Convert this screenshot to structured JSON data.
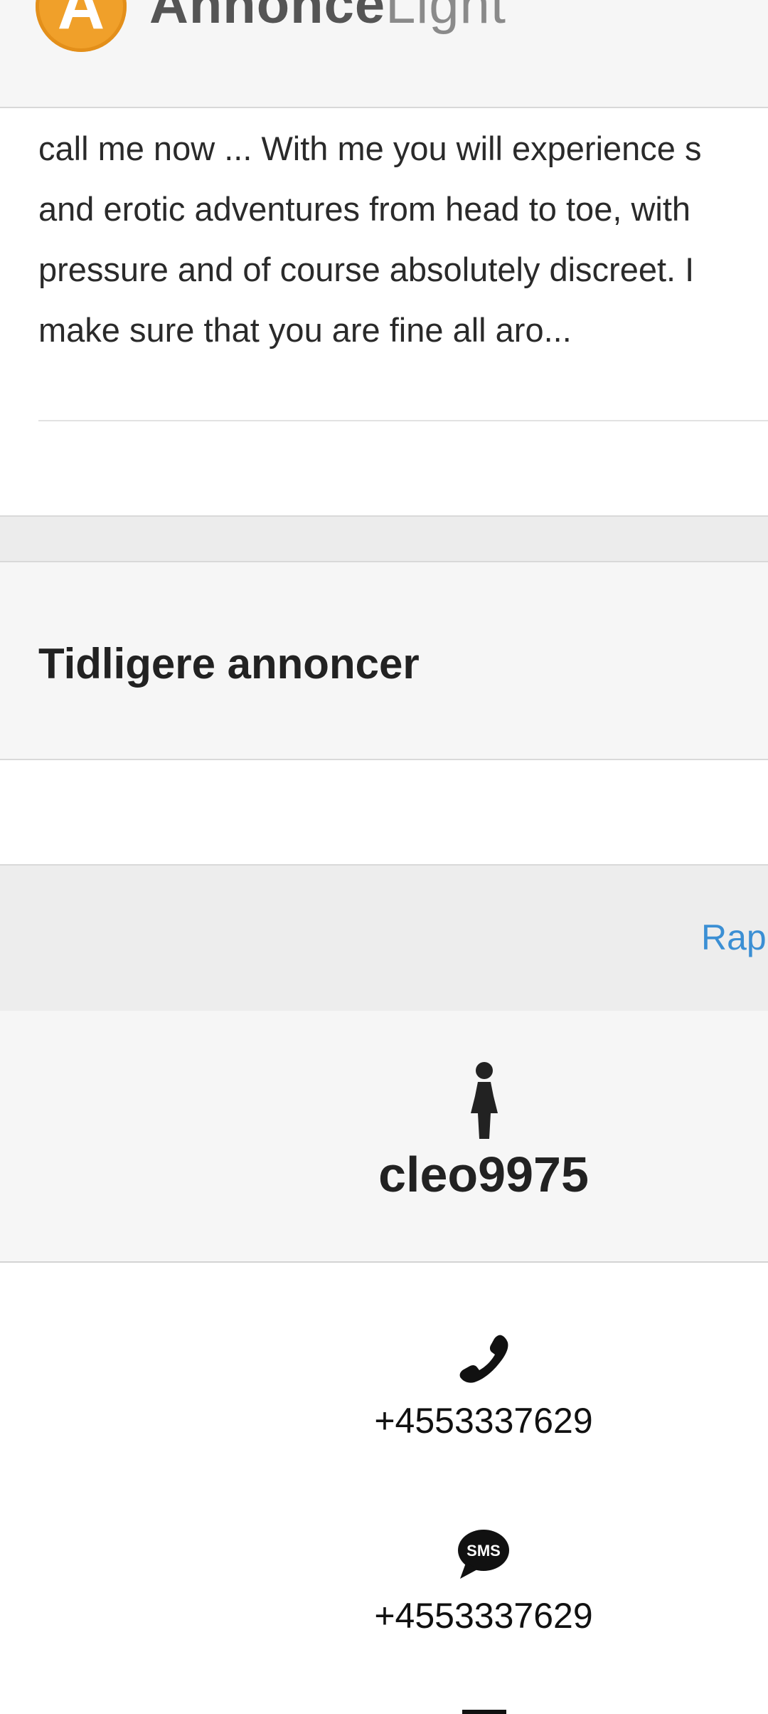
{
  "header": {
    "logo_letter": "A",
    "brand_bold": "Annonce",
    "brand_light": "Light"
  },
  "ad": {
    "description_lines": [
      "call me now ... With me you will experience s",
      "and erotic adventures from head to toe, with",
      "pressure and of course absolutely discreet. I",
      "make sure that you are fine all aro..."
    ]
  },
  "previous_ads": {
    "title": "Tidligere annoncer"
  },
  "report": {
    "label": "Rap"
  },
  "user": {
    "gender_icon": "female-icon",
    "username": "cleo9975"
  },
  "contact": {
    "phone_icon": "phone-icon",
    "phone": "+4553337629",
    "sms_icon": "sms-icon",
    "sms_label": "SMS",
    "sms": "+4553337629"
  },
  "colors": {
    "brand_orange": "#f0a02a",
    "link_blue": "#3b8fd4",
    "panel_grey": "#f6f6f6",
    "band_grey": "#ececec"
  }
}
